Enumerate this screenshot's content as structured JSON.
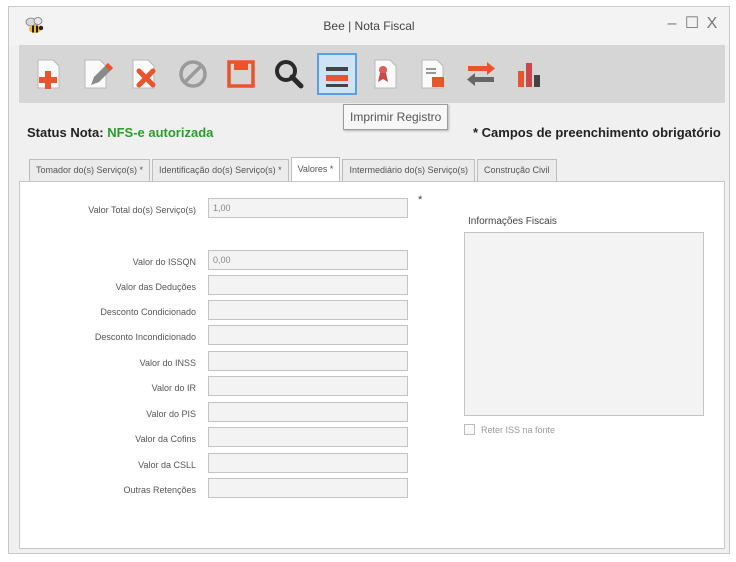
{
  "window": {
    "title": "Bee | Nota Fiscal"
  },
  "window_controls": {
    "minimize": "–",
    "maximize": "☐",
    "close": "X"
  },
  "toolbar": {
    "buttons": [
      {
        "name": "add-icon"
      },
      {
        "name": "edit-icon"
      },
      {
        "name": "delete-icon"
      },
      {
        "name": "cancel-icon"
      },
      {
        "name": "save-icon"
      },
      {
        "name": "search-icon"
      },
      {
        "name": "print-icon"
      },
      {
        "name": "document-ribbon-icon"
      },
      {
        "name": "document-export-icon"
      },
      {
        "name": "transfer-icon"
      },
      {
        "name": "bar-chart-icon"
      }
    ],
    "tooltip": "Imprimir Registro"
  },
  "status": {
    "label": "Status Nota:",
    "value": "NFS-e autorizada",
    "value_color": "#2a9d2a",
    "required_note": "* Campos de preenchimento obrigatório"
  },
  "tabs": [
    {
      "label": "Tomador do(s) Serviço(s) *",
      "active": false
    },
    {
      "label": "Identificação do(s) Serviço(s) *",
      "active": false
    },
    {
      "label": "Valores *",
      "active": true
    },
    {
      "label": "Intermediário do(s) Serviço(s)",
      "active": false
    },
    {
      "label": "Construção Civil",
      "active": false
    }
  ],
  "form": {
    "total": {
      "label": "Valor Total do(s) Serviço(s)",
      "value": "1,00",
      "required_mark": "*"
    },
    "fields": [
      {
        "label": "Valor do ISSQN",
        "value": "0,00"
      },
      {
        "label": "Valor das Deduções",
        "value": ""
      },
      {
        "label": "Desconto Condicionado",
        "value": ""
      },
      {
        "label": "Desconto Incondicionado",
        "value": ""
      },
      {
        "label": "Valor do INSS",
        "value": ""
      },
      {
        "label": "Valor do IR",
        "value": ""
      },
      {
        "label": "Valor do PIS",
        "value": ""
      },
      {
        "label": "Valor da Cofins",
        "value": ""
      },
      {
        "label": "Valor da CSLL",
        "value": ""
      },
      {
        "label": "Outras Retenções",
        "value": ""
      }
    ]
  },
  "info": {
    "label": "Informações Fiscais",
    "value": "",
    "retain_iss_label": "Reter ISS na fonte",
    "retain_iss_checked": false
  }
}
